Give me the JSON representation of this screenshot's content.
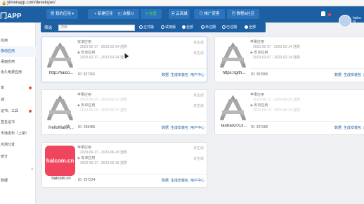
{
  "browser": {
    "url": "yimenapp.com/developer/"
  },
  "header": {
    "logo": "门APP",
    "nav": [
      {
        "label": "我的应用",
        "icon": "grid-icon"
      },
      {
        "label": "新建应用",
        "icon": "plus-icon"
      },
      {
        "label": "余额 0",
        "icon": "wallet-icon"
      },
      {
        "label": "充值",
        "icon": "yen-icon"
      },
      {
        "label": "云商城",
        "icon": "shop-icon"
      },
      {
        "label": "推广获客",
        "icon": "share-icon"
      },
      {
        "label": "教程&社区",
        "icon": "book-icon"
      }
    ],
    "user_name": "halco m"
  },
  "sidebar": {
    "items": [
      {
        "label": "应用"
      },
      {
        "label": "移动应用"
      },
      {
        "label": "桌面应用"
      },
      {
        "label": "永久免费应用"
      },
      {
        "label": "单",
        "dot": true
      },
      {
        "label": "城"
      },
      {
        "label": "证书、工具",
        "dot": true
      },
      {
        "label": "签名证书"
      },
      {
        "label": "市场发布（上架）"
      },
      {
        "label": "内测分发"
      },
      {
        "label": "统计"
      },
      {
        "label": "",
        "chevron": "▾"
      },
      {
        "label": "数据"
      }
    ]
  },
  "filter": {
    "label": "筛选",
    "search_placeholder": "搜索",
    "options_a": [
      "正式版",
      "试用版",
      "全部"
    ],
    "options_b": [
      "未过期",
      "已过期",
      "全部"
    ]
  },
  "cards": [
    {
      "name": "http://halco...",
      "type1": "安卓应用",
      "date1": "2023-02-17 - 2023-02-24 选购",
      "type2": "安卓应用",
      "date2": "2023-02-17 - 2023-02-24 选购",
      "status": "未生成",
      "id": "ID: 327116",
      "actions": [
        "数据",
        "生成安装包",
        "用户中心"
      ]
    },
    {
      "name": "https://gith...",
      "type1": "苹果应用",
      "date1": "2023-02-07 - 2023-02-14 选购",
      "type2": "安卓应用",
      "date2": "2023-02-07 - 2023-02-14 选购",
      "status": "未生成",
      "id": "ID: 302966",
      "actions": [
        "数据",
        "生成安装包",
        "用户中心"
      ]
    },
    {
      "name": "HelloMall购...",
      "type1": "苹果应用",
      "date1": "2023-06-23 - 2023-06-30 选购",
      "type2": "安卓应用",
      "date2": "2023-06-23 - 2023-06-30 选购",
      "status": "未生成",
      "id": "ID: 298485",
      "actions": [
        "数据",
        "生成安装包",
        "用户中心"
      ]
    },
    {
      "name": "taobao2013...",
      "type1": "苹果应用",
      "date1": "2023-06-13 - 2023-06-20 选购",
      "type2": "安卓应用",
      "date2": "2023-06-13 - 2023-06-20 选购",
      "status": "未生成",
      "id": "ID: 297680",
      "actions": [
        "数据",
        "生成安装包",
        "用户中心"
      ]
    },
    {
      "name": "halcom.cn",
      "icon_text": "halcom.cn",
      "type1": "苹果应用",
      "date1": "2023-06-17 - 2023-06-18 选购",
      "type2": "安卓应用",
      "date2": "2023-06-17 - 2023-06-18 选购",
      "status": "未生成",
      "id": "ID: 297234",
      "actions": [
        "数据",
        "生成安装包",
        "用户中心"
      ]
    }
  ],
  "colors": {
    "nav": "#1d5fa3",
    "accent": "#2b73bc",
    "badge": "#e74c3c",
    "halcom": "#f0455c"
  }
}
